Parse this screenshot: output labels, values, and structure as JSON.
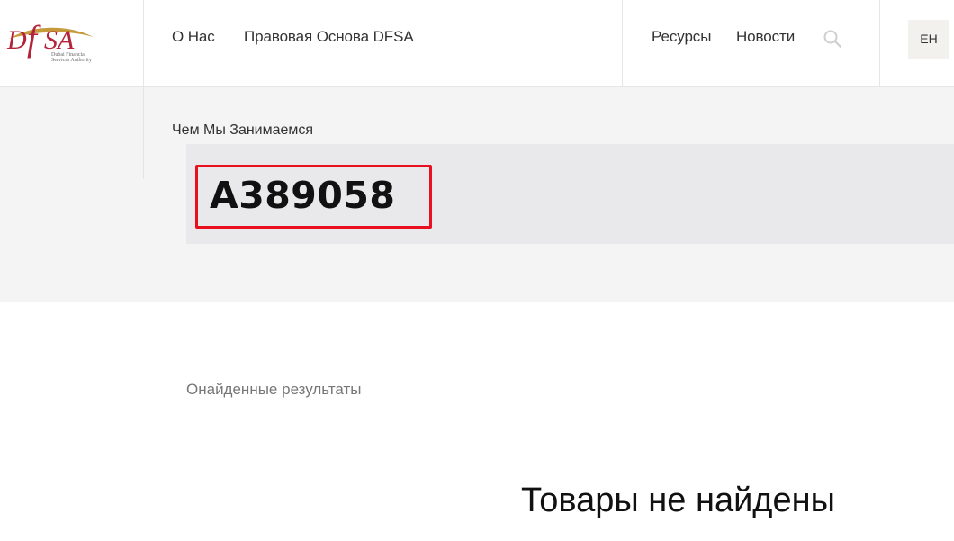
{
  "brand": {
    "logo_text": "DFSA",
    "logo_subtext_line1": "Dubai Financial",
    "logo_subtext_line2": "Services Authority",
    "logo_color": "#b3233a",
    "logo_swoosh_color": "#c49a3a"
  },
  "nav": {
    "about": "О Нас",
    "legal": "Правовая Основа DFSA",
    "resources": "Ресурсы",
    "news": "Новости",
    "search_icon": "search-icon",
    "language": "EH"
  },
  "hero": {
    "section_label": "Чем Мы Занимаемся",
    "search_query": "A389058",
    "highlight_color": "#e8101f"
  },
  "results": {
    "label": "Онайденные результаты",
    "empty_message": "Товары не найдены"
  }
}
